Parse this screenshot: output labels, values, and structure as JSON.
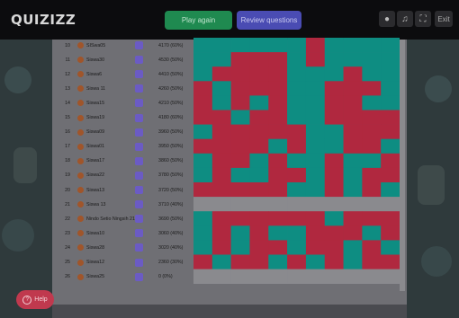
{
  "header": {
    "logo": "QUIZIZZ",
    "play_again": "Play again",
    "review_questions": "Review questions",
    "exit": "Exit"
  },
  "help": {
    "label": "Help"
  },
  "players": [
    {
      "rank": "10",
      "name": "SISwa05",
      "score": "4170 (60%)"
    },
    {
      "rank": "11",
      "name": "Siswa30",
      "score": "4530 (50%)"
    },
    {
      "rank": "12",
      "name": "Siswa6",
      "score": "4410 (50%)"
    },
    {
      "rank": "13",
      "name": "Siswa 11",
      "score": "4260 (50%)"
    },
    {
      "rank": "14",
      "name": "Siswa15",
      "score": "4210 (50%)"
    },
    {
      "rank": "15",
      "name": "Siswa19",
      "score": "4180 (60%)"
    },
    {
      "rank": "16",
      "name": "Siswa09",
      "score": "3960 (50%)"
    },
    {
      "rank": "17",
      "name": "Siswa01",
      "score": "3950 (50%)"
    },
    {
      "rank": "18",
      "name": "Siswa17",
      "score": "3860 (50%)"
    },
    {
      "rank": "19",
      "name": "Siswa22",
      "score": "3780 (50%)"
    },
    {
      "rank": "20",
      "name": "Siswa13",
      "score": "3720 (50%)"
    },
    {
      "rank": "21",
      "name": "Siswa 13",
      "score": "3710 (40%)"
    },
    {
      "rank": "22",
      "name": "Nindo Setio Ningsih 21",
      "score": "3690 (50%)"
    },
    {
      "rank": "23",
      "name": "Siswa10",
      "score": "3060 (40%)"
    },
    {
      "rank": "24",
      "name": "Siswa28",
      "score": "3020 (40%)"
    },
    {
      "rank": "25",
      "name": "Siswa12",
      "score": "2360 (30%)"
    },
    {
      "rank": "26",
      "name": "Siswa25",
      "score": "0 (0%)"
    }
  ],
  "answer_grid": [
    "GGGGGGRGGGG",
    "GGRRRGRGGGG",
    "GRRRRGGGRGG",
    "RGRRRGGRRRG",
    "RGRGRGGRRGG",
    "RRGRRGGRRRR",
    "GRRRRRGGRRR",
    "RRRRGRGGRRG",
    "GRRGRGGRGGR",
    "GRGGRRGRGRR",
    "RRRRRGGRGRG",
    "EEEEEEEEEEE",
    "GRRRRRRGRRR",
    "GRGRGGRRRGR",
    "GRGRRGRRGRG",
    "RGRRGRGRGRR",
    "EEEEEEEEEEE"
  ],
  "colors": {
    "correct": "#0e8d82",
    "incorrect": "#b0283f",
    "empty": "#8a8a8e"
  }
}
